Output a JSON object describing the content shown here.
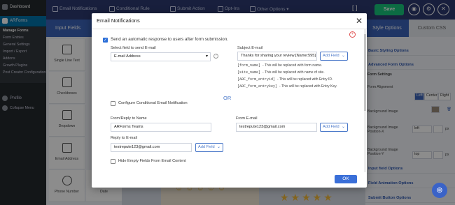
{
  "wp_sidebar": {
    "dashboard": "Dashboard",
    "plugin": "ARForms",
    "items": [
      "Manage Forms",
      "Form Entries",
      "General Settings",
      "Import / Export",
      "Addons",
      "Growth Plugins",
      "Post Creator Configuration"
    ],
    "profile": "Profile",
    "collapse": "Collapse Menu"
  },
  "header": {
    "tabs": [
      "Email Notifications",
      "Conditional Rule",
      "Submit Action",
      "Opt-Ins",
      "Other Options"
    ],
    "save_label": "Save"
  },
  "left_panel": {
    "title": "Input Fields",
    "fields": [
      "Single Line Text",
      "Checkboxes",
      "Dropdown",
      "Email Address",
      "Phone Number",
      "Date"
    ]
  },
  "right_panel": {
    "tabs": [
      "Style Options",
      "Custom CSS"
    ],
    "sections": [
      "Basic Styling Options",
      "Advanced Form Options",
      "Input field Options",
      "Field Animation Options",
      "Submit Button Options"
    ],
    "form_settings": "Form Settings",
    "form_alignment": "Form Alignment",
    "align_options": [
      "Left",
      "Center",
      "Right"
    ],
    "bg_image": "Background Image",
    "bg_pos_x": "Background Image Position-X",
    "bg_pos_x_value": "left",
    "bg_pos_y": "Background Image Position-Y",
    "bg_pos_y_value": "top",
    "unit": "px",
    "colors": {
      "header": "#2c3a6f",
      "accent": "#3b63b8",
      "save": "#17c57a"
    }
  },
  "modal": {
    "title": "Email Notifications",
    "send_auto": "Send an automatic response to users after form submission.",
    "select_field_label": "Select field to send E-mail",
    "select_field_value": "E-mail Address",
    "subject_label": "Subject E-mail",
    "subject_value": "Thanks for sharing your review [Name:595]",
    "add_field": "Add Field",
    "codes": [
      {
        "tag": "[form_name]",
        "desc": "- This will be replaced with form name."
      },
      {
        "tag": "[site_name]",
        "desc": "- This will be replaced with name of site."
      },
      {
        "tag": "[ARF_form_entryid]",
        "desc": "- This will be replaced with Entry ID."
      },
      {
        "tag": "[ARF_form_entrykey]",
        "desc": "- This will be replaced with Entry Key."
      }
    ],
    "conditional": "Configure Conditional Email Notification",
    "or": "OR",
    "from_name_label": "From/Reply to Name",
    "from_name_value": "ARForms Teams",
    "from_email_label": "From E-mail",
    "from_email_value": "testrepute123@gmail.com",
    "reply_label": "Reply to E-mail",
    "reply_value": "testrepute123@gmail.com",
    "hide_empty": "Hide Empty Fields From Email Content",
    "ok": "OK"
  }
}
